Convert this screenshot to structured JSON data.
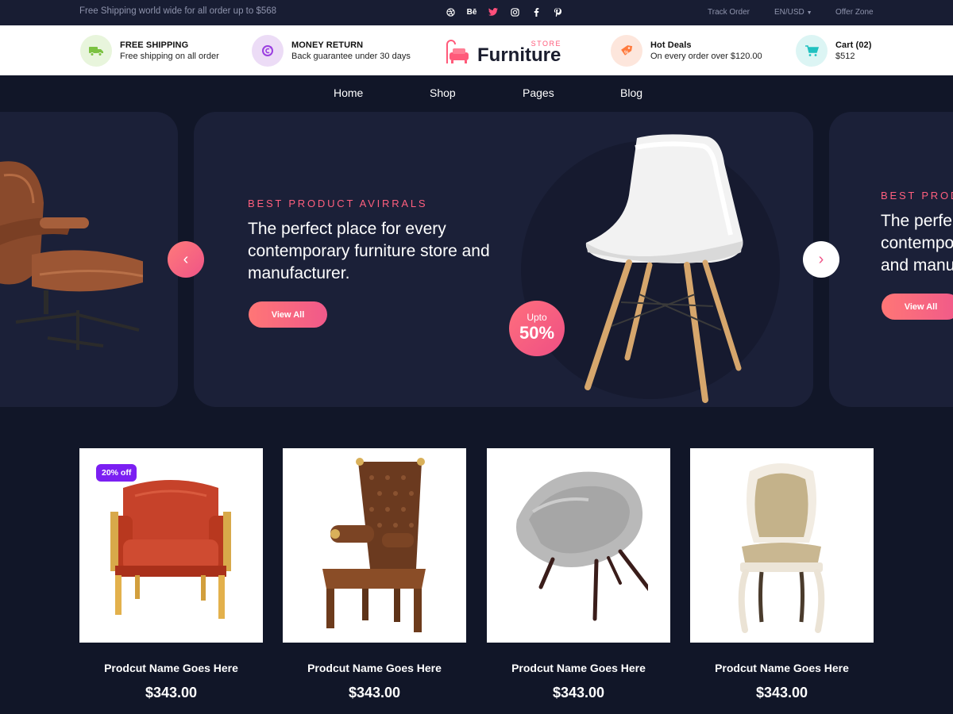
{
  "topbar": {
    "promo": "Free Shipping world wide for all order up to $568",
    "social_icons": [
      "dribbble-icon",
      "behance-icon",
      "twitter-icon",
      "instagram-icon",
      "facebook-icon",
      "pinterest-icon"
    ],
    "behance_glyph": "Bē",
    "track_order": "Track Order",
    "currency": "EN/USD",
    "offer_zone": "Offer Zone"
  },
  "infobar": {
    "shipping": {
      "title": "FREE SHIPPING",
      "subtitle": "Free shipping on all order",
      "icon": "truck-icon",
      "bg": "#e8f5dc",
      "fg": "#7cc242"
    },
    "money": {
      "title": "MONEY RETURN",
      "subtitle": "Back guarantee under 30 days",
      "icon": "money-return-icon",
      "bg": "#ecdcf6",
      "fg": "#9a3ee0"
    },
    "logo": {
      "store": "STORE",
      "word": "Furniture"
    },
    "deals": {
      "title": "Hot Deals",
      "subtitle": "On every order over $120.00",
      "icon": "tag-icon",
      "bg": "#fde6dc",
      "fg": "#ff7a3d"
    },
    "cart": {
      "title": "Cart (02)",
      "subtitle": "$512",
      "icon": "cart-icon",
      "bg": "#dcf5f4",
      "fg": "#21c1c0"
    }
  },
  "nav": {
    "items": [
      "Home",
      "Shop",
      "Pages",
      "Blog"
    ]
  },
  "hero": {
    "eyebrow": "BEST PRODUCT AVIRRALS",
    "headline": "The perfect place for every contemporary furniture store and manufacturer.",
    "button": "View All",
    "badge_top": "Upto",
    "badge_value": "50%",
    "next_eyebrow": "BEST PROD",
    "next_headline": "The perfe contempo and manu",
    "next_button": "View All",
    "prev_arrow": "‹",
    "next_arrow": "›"
  },
  "products": [
    {
      "name": "Prodcut Name Goes Here",
      "price": "$343.00",
      "badge": "20% off"
    },
    {
      "name": "Prodcut Name Goes Here",
      "price": "$343.00"
    },
    {
      "name": "Prodcut Name Goes Here",
      "price": "$343.00"
    },
    {
      "name": "Prodcut Name Goes Here",
      "price": "$343.00"
    }
  ],
  "colors": {
    "accent": "#ff5f7e",
    "background": "#111628",
    "card": "#1b2038",
    "badge_purple": "#7b1ff2"
  }
}
